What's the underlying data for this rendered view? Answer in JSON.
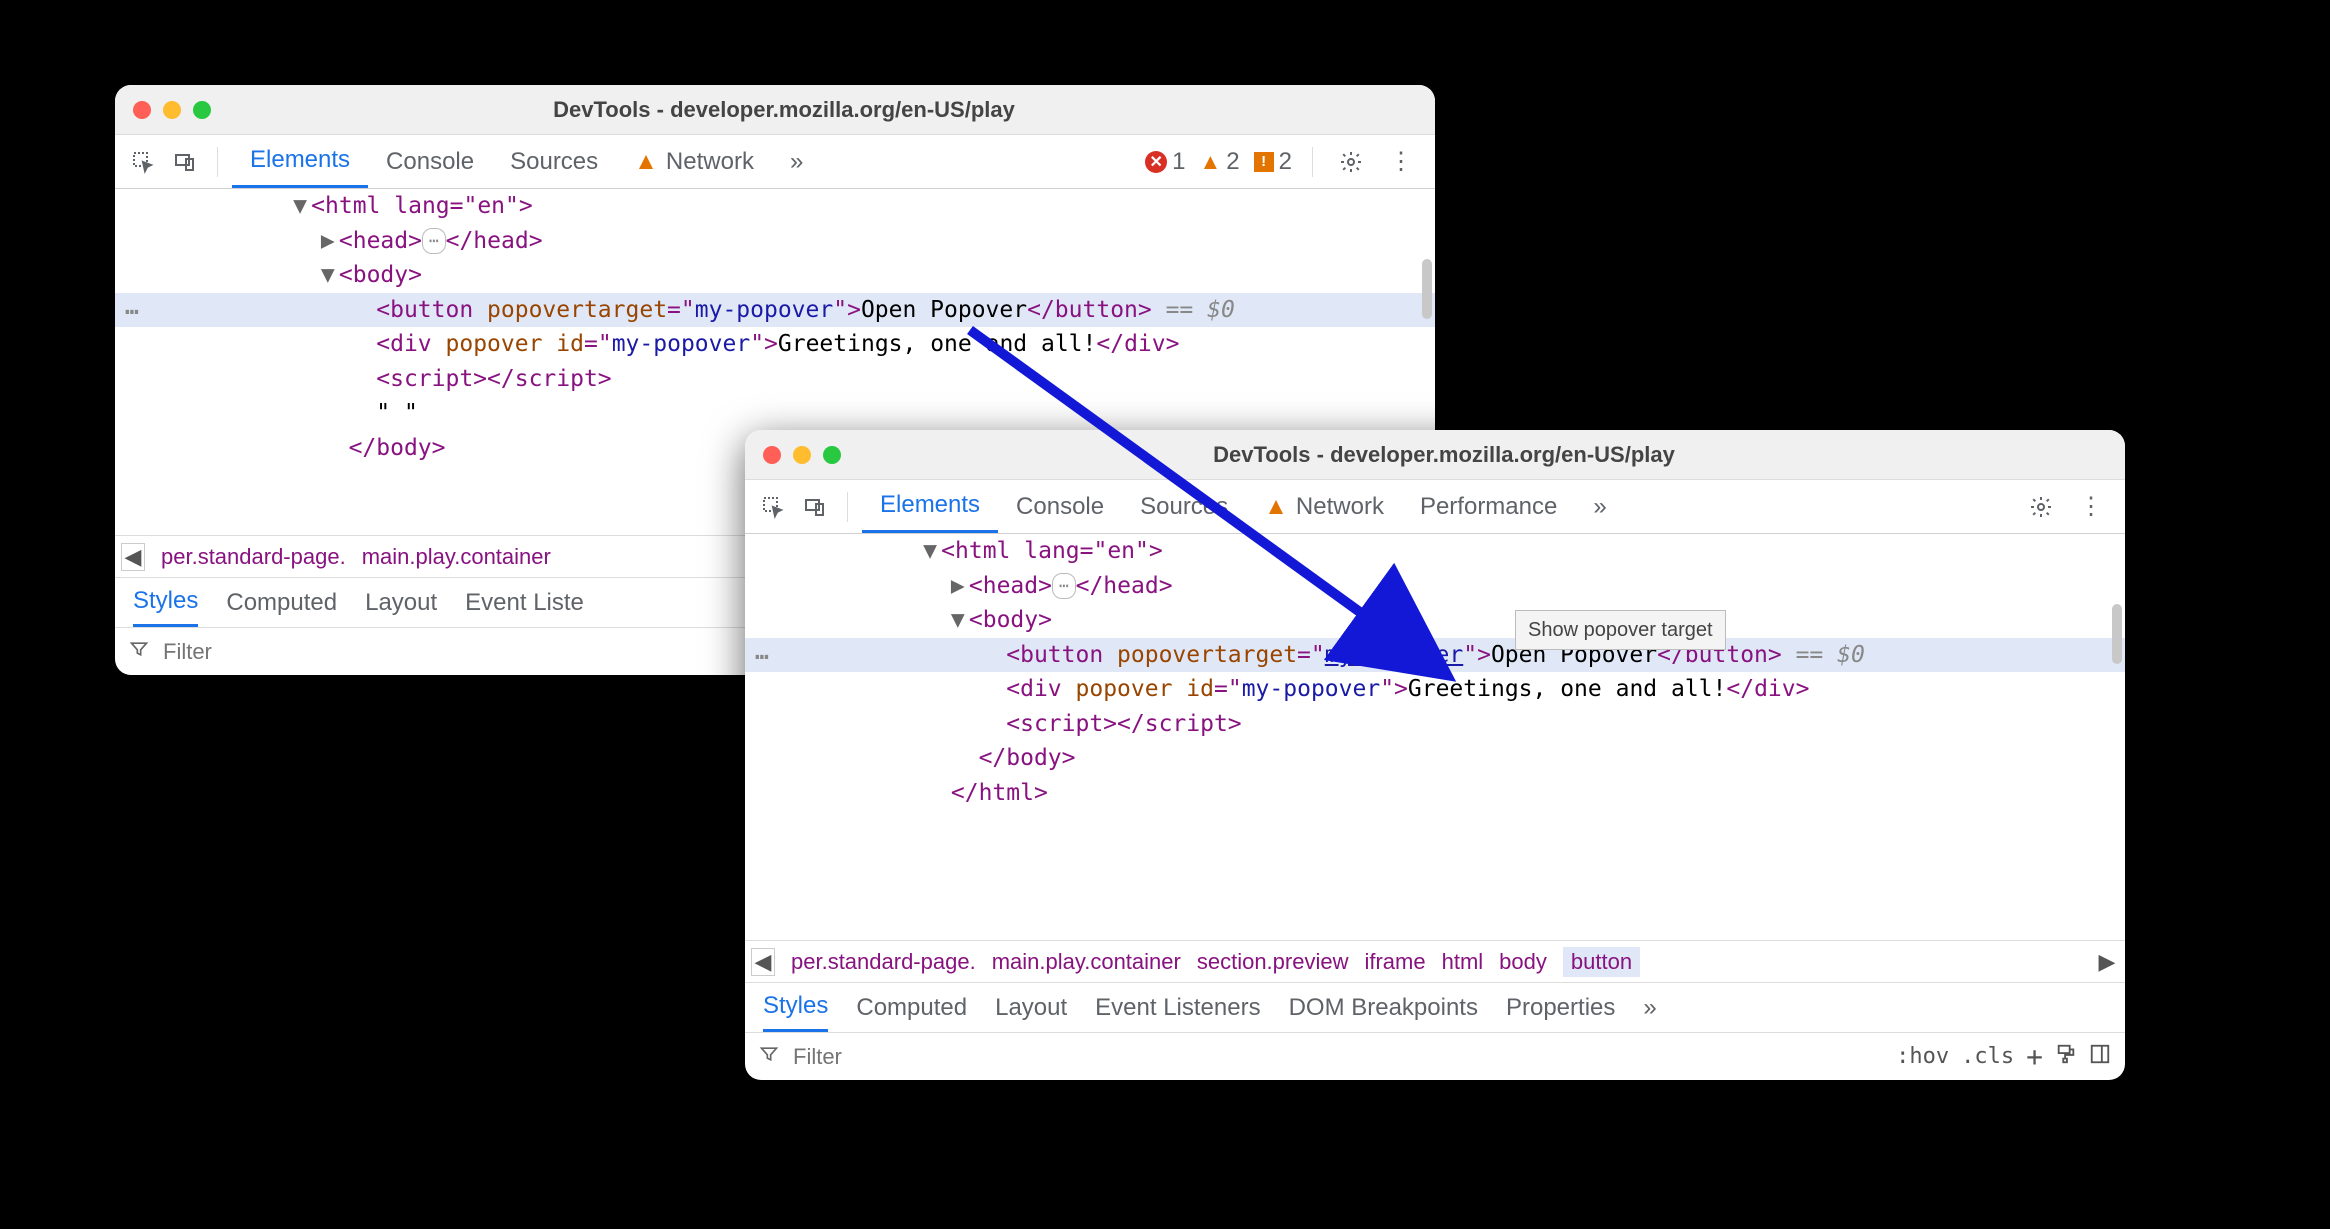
{
  "window1": {
    "title": "DevTools - developer.mozilla.org/en-US/play",
    "toolbar": {
      "tabs": [
        "Elements",
        "Console",
        "Sources",
        "Network"
      ],
      "network_has_warning": true,
      "overflow": "»",
      "badges": {
        "errors": "1",
        "warnings": "2",
        "issues": "2"
      }
    },
    "dom": {
      "html_open": "<html lang=\"en\">",
      "head": {
        "open": "<head>",
        "ellipsis": "⋯",
        "close": "</head>"
      },
      "body_open": "<body>",
      "button_line": {
        "open_tag": "<button ",
        "attr": "popovertarget",
        "eq": "=\"",
        "val": "my-popover",
        "close_attr": "\">",
        "text": "Open Popover",
        "close_tag": "</button>",
        "ref": " == $0"
      },
      "div_line": {
        "open": "<div ",
        "attr1": "popover",
        "attr2": "id",
        "val2": "my-popover",
        "text": "Greetings, one and all!",
        "close": "</div>"
      },
      "script_line": {
        "open": "<script>",
        "close": "</script>"
      },
      "quote_line": "\" \"",
      "body_close": "</body>"
    },
    "breadcrumb": {
      "item1": "per.standard-page.",
      "item2": "main.play.container"
    },
    "styles_tabs": [
      "Styles",
      "Computed",
      "Layout",
      "Event Liste"
    ],
    "filter_placeholder": "Filter"
  },
  "window2": {
    "title": "DevTools - developer.mozilla.org/en-US/play",
    "toolbar": {
      "tabs": [
        "Elements",
        "Console",
        "Sources",
        "Network",
        "Performance"
      ],
      "network_has_warning": true,
      "overflow": "»"
    },
    "dom": {
      "html_open": "<html lang=\"en\">",
      "head": {
        "open": "<head>",
        "ellipsis": "⋯",
        "close": "</head>"
      },
      "body_open": "<body>",
      "button_line": {
        "open_tag": "<button ",
        "attr": "popovertarget",
        "eq": "=\"",
        "val": "my-popover",
        "close_attr": "\">",
        "text": "Open Popover",
        "close_tag": "</button>",
        "ref": " == $0"
      },
      "div_line": {
        "open": "<div ",
        "attr1": "popover",
        "attr2": "id",
        "val2": "my-popover",
        "text": "Greetings, one and all!",
        "close": "</div>"
      },
      "script_line": {
        "open": "<script>",
        "close": "</script>"
      },
      "body_close": "</body>",
      "html_close": "</html>"
    },
    "tooltip": "Show popover target",
    "breadcrumb": {
      "items": [
        "per.standard-page.",
        "main.play.container",
        "section.preview",
        "iframe",
        "html",
        "body",
        "button"
      ]
    },
    "styles_tabs": [
      "Styles",
      "Computed",
      "Layout",
      "Event Listeners",
      "DOM Breakpoints",
      "Properties"
    ],
    "overflow": "»",
    "filter_placeholder": "Filter",
    "filter_tools": {
      "hov": ":hov",
      "cls": ".cls"
    }
  }
}
